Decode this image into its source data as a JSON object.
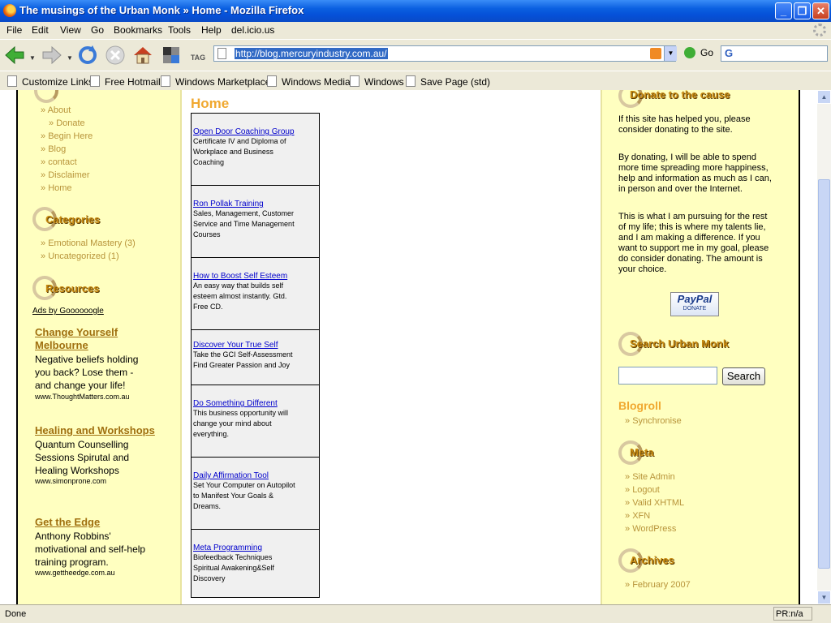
{
  "window": {
    "title": "The musings of the Urban Monk » Home - Mozilla Firefox"
  },
  "menu": [
    "File",
    "Edit",
    "View",
    "Go",
    "Bookmarks",
    "Tools",
    "Help",
    "del.icio.us"
  ],
  "toolbar": {
    "tag_label": "TAG",
    "url": "http://blog.mercuryindustry.com.au/",
    "go_label": "Go"
  },
  "bookmarks": [
    "Customize Links",
    "Free Hotmail",
    "Windows Marketplace",
    "Windows Media",
    "Windows",
    "Save Page (std)"
  ],
  "left_sidebar": {
    "pages": [
      "About",
      "Donate",
      "Begin Here",
      "Blog",
      "contact",
      "Disclaimer",
      "Home"
    ],
    "categories_title": "Categories",
    "categories": [
      "Emotional Mastery (3)",
      "Uncategorized (1)"
    ],
    "resources_title": "Resources",
    "ads_label": "Ads by Goooooogle",
    "ads": [
      {
        "title1": "Change Yourself",
        "title2": "Melbourne",
        "text": [
          "Negative beliefs holding",
          "you back? Lose them -",
          "and change your life!"
        ],
        "url": "www.ThoughtMatters.com.au"
      },
      {
        "title1": "Healing and Workshops",
        "title2": "",
        "text": [
          "Quantum Counselling",
          "Sessions Spirutal and",
          "Healing Workshops"
        ],
        "url": "www.simonprone.com"
      },
      {
        "title1": "Get the Edge",
        "title2": "",
        "text": [
          "Anthony Robbins'",
          "motivational and self-help",
          "training program."
        ],
        "url": "www.gettheedge.com.au"
      }
    ]
  },
  "main": {
    "heading": "Home",
    "ads": [
      {
        "link": "Open Door Coaching Group",
        "desc": [
          "Certificate IV and Diploma of",
          "Workplace and Business",
          "Coaching"
        ]
      },
      {
        "link": "Ron Pollak Training",
        "desc": [
          "Sales, Management, Customer",
          "Service and Time Management",
          "Courses"
        ]
      },
      {
        "link": "How to Boost Self Esteem",
        "desc": [
          "An easy way that builds self",
          "esteem almost instantly. Gtd.",
          "Free CD."
        ]
      },
      {
        "link": "Discover Your True Self",
        "desc": [
          "Take the GCI Self-Assessment",
          "Find Greater Passion and Joy"
        ]
      },
      {
        "link": "Do Something Different",
        "desc": [
          "This business opportunity will",
          "change your mind about",
          "everything."
        ]
      },
      {
        "link": "Daily Affirmation Tool",
        "desc": [
          "Set Your Computer on Autopilot",
          "to Manifest Your Goals &",
          "Dreams."
        ]
      },
      {
        "link": "Meta Programming",
        "desc": [
          "Biofeedback Techniques",
          "Spiritual Awakening&Self",
          "Discovery"
        ]
      }
    ]
  },
  "right_sidebar": {
    "donate_title": "Donate to the cause",
    "donate_p1": "If this site has helped you, please consider donating to the site.",
    "donate_p2": "By donating, I will be able to spend more time spreading more happiness, help and information as much as I can, in person and over the Internet.",
    "donate_p3": "This is what I am pursuing for the rest of my life; this is where my talents lie, and I am making a difference. If you want to support me in my goal, please do consider donating. The amount is your choice.",
    "paypal_label": "PayPal",
    "paypal_sub": "DONATE",
    "search_title": "Search Urban Monk",
    "search_button": "Search",
    "blogroll_title": "Blogroll",
    "blogroll": [
      "Synchronise"
    ],
    "meta_title": "Meta",
    "meta": [
      "Site Admin",
      "Logout",
      "Valid XHTML",
      "XFN",
      "WordPress"
    ],
    "archives_title": "Archives",
    "archives": [
      "February 2007"
    ]
  },
  "status": {
    "text": "Done",
    "right": "PR:n/a"
  }
}
